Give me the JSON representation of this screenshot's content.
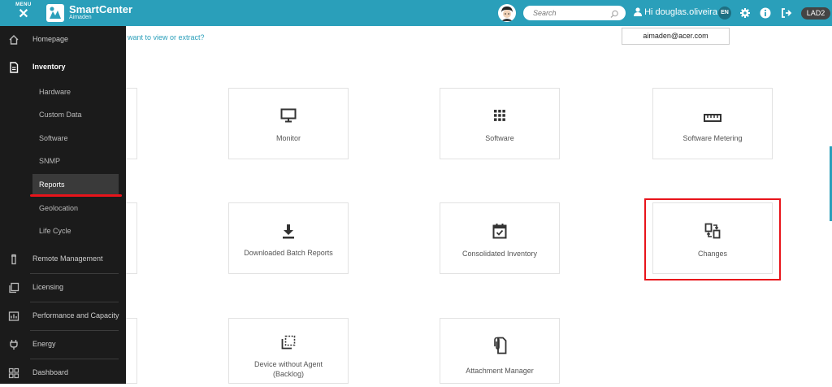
{
  "topbar": {
    "menu_label": "MENU",
    "menu_close_glyph": "✕",
    "brand_name": "SmartCenter",
    "brand_sub": "Aimaden",
    "search_placeholder": "Search",
    "user_greeting": "Hi douglas.oliveira",
    "language": "EN",
    "environment_badge": "LAD2",
    "accent_color": "#2a9fba"
  },
  "page": {
    "question": "want to view or extract?",
    "email": "aimaden@acer.com"
  },
  "sidebar": {
    "items": [
      {
        "label": "Homepage",
        "icon": "home-icon"
      },
      {
        "label": "Inventory",
        "icon": "document-icon"
      },
      {
        "label": "Remote Management",
        "icon": "remote-icon"
      },
      {
        "label": "Licensing",
        "icon": "licensing-icon"
      },
      {
        "label": "Performance and Capacity",
        "icon": "performance-icon"
      },
      {
        "label": "Energy",
        "icon": "energy-icon"
      },
      {
        "label": "Dashboard",
        "icon": "dashboard-icon"
      }
    ],
    "inventory_sub": [
      {
        "label": "Hardware"
      },
      {
        "label": "Custom Data"
      },
      {
        "label": "Software"
      },
      {
        "label": "SNMP"
      },
      {
        "label": "Reports"
      },
      {
        "label": "Geolocation"
      },
      {
        "label": "Life Cycle"
      }
    ]
  },
  "cards": {
    "monitor": "Monitor",
    "software": "Software",
    "software_metering": "Software Metering",
    "downloaded_batch_reports": "Downloaded Batch Reports",
    "consolidated_inventory": "Consolidated Inventory",
    "changes": "Changes",
    "device_without_agent_line1": "Device without Agent",
    "device_without_agent_line2": "(Backlog)",
    "attachment_manager": "Attachment Manager"
  },
  "highlight_color": "#e8141b"
}
